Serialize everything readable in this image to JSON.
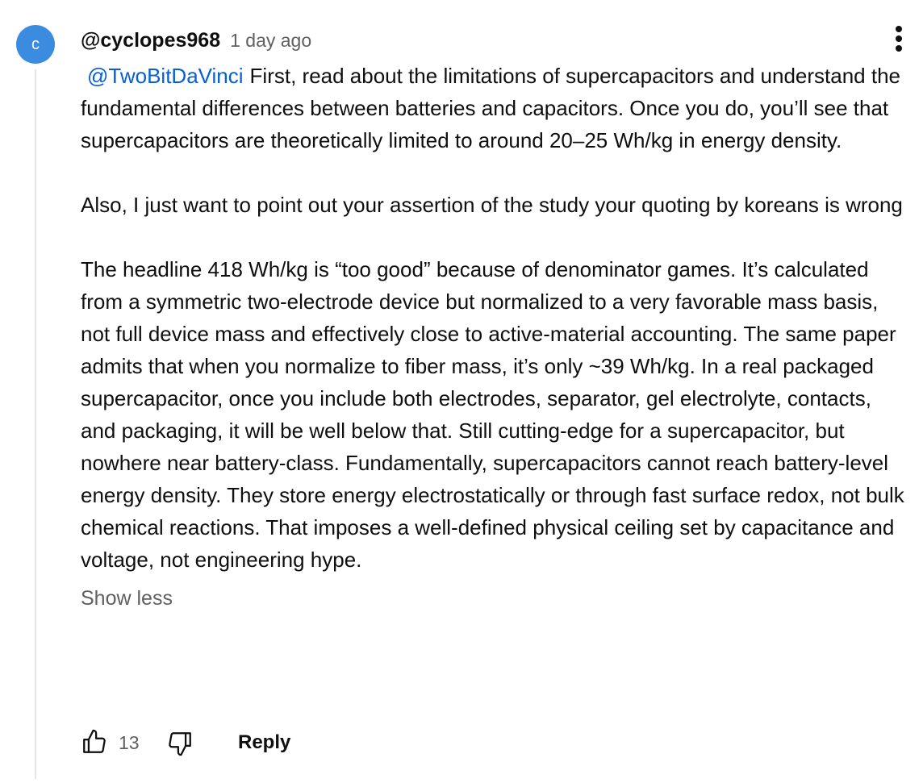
{
  "avatar": {
    "initial": "c",
    "color": "#3b8ce0"
  },
  "comment": {
    "author": "@cyclopes968",
    "time": "1 day ago",
    "mention": "@TwoBitDaVinci",
    "paragraph1": "First, read about the limitations of supercapacitors and understand the fundamental differences between batteries and capacitors. Once you do, you’ll see that supercapacitors are theoretically limited to around 20–25 Wh/kg in energy density.",
    "paragraph2": "Also, I just want to point out your assertion of the study your quoting by koreans is wrong",
    "paragraph3": "The headline 418 Wh/kg is “too good” because of denominator games. It’s calculated from a symmetric two-electrode device but normalized to a very favorable mass basis, not full device mass and effectively close to active-material accounting. The same paper admits that when you normalize to fiber mass, it’s only ~39 Wh/kg. In a real packaged supercapacitor, once you include both electrodes, separator, gel electrolyte, contacts, and packaging, it will be well below that. Still cutting-edge for a supercapacitor, but nowhere near battery-class. Fundamentally, supercapacitors cannot reach battery-level energy density. They store energy electrostatically or through fast surface redox, not bulk chemical reactions. That imposes a well-defined physical ceiling set by capacitance and voltage, not engineering hype.",
    "show_less": "Show less"
  },
  "actions": {
    "like_icon": "thumbs-up-icon",
    "like_count": "13",
    "dislike_icon": "thumbs-down-icon",
    "reply_label": "Reply",
    "more_icon": "more-vertical-icon"
  },
  "colors": {
    "mention": "#065fd4",
    "secondary_text": "#606060"
  }
}
